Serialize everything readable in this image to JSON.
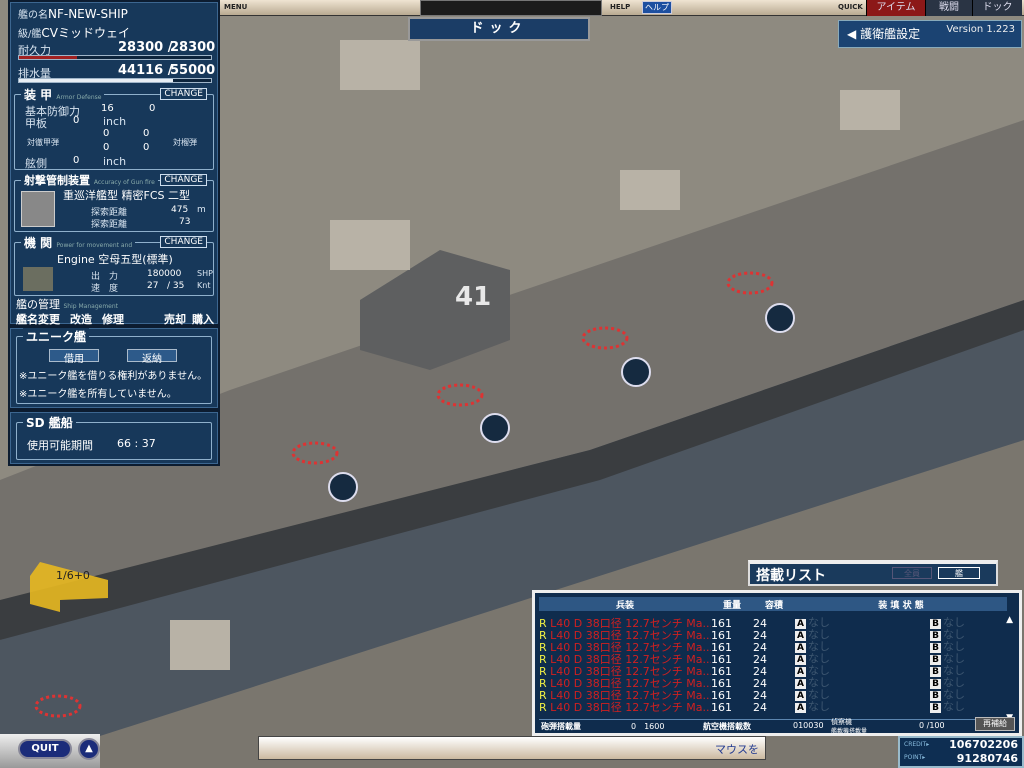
{
  "top": {
    "menu": "MENU",
    "title_bar": "",
    "help": "HELP",
    "help_btn": "ヘルプ",
    "quick": "QUICK",
    "tabs": [
      "アイテム",
      "戦闘",
      "ドック"
    ]
  },
  "screen_title": "ドック",
  "escort_button": "護衛艦設定",
  "version": "Version 1.223",
  "ship": {
    "name_label": "艦の名",
    "name": "NF-NEW-SHIP",
    "class_label": "級/艦",
    "class": "CVミッドウェイ",
    "hp_label": "耐久力",
    "hp": "28300 /",
    "hp_max": "28300",
    "hp_fraction": 0.3,
    "disp_label": "排水量",
    "disp": "44116 /",
    "disp_max": "55000",
    "disp_fraction": 0.8
  },
  "armor": {
    "title": "装 甲",
    "sub": "Armor Defense",
    "change": "CHANGE",
    "base_label": "基本防御力",
    "base": "16",
    "base2": "0",
    "deck_label": "甲板",
    "deck": "0",
    "unit": "inch",
    "vs_ap": "対徹甲弾",
    "vs_he": "対榴弾",
    "v1": "0",
    "v2": "0",
    "v3": "0",
    "v4": "0",
    "side_label": "舷側",
    "side": "0"
  },
  "fcs": {
    "title": "射撃管制装置",
    "sub": "Accuracy of Gun fire",
    "change": "CHANGE",
    "name": "重巡洋艦型 精密FCS 二型",
    "r1_label": "探索距離",
    "r1": "475",
    "r1_unit": "m",
    "r2_label": "探索距離",
    "r2": "73"
  },
  "engine": {
    "title": "機 関",
    "sub": "Power for movement and",
    "change": "CHANGE",
    "name": "Engine 空母五型(標準)",
    "out_label": "出　力",
    "out": "180000",
    "out_unit": "SHP",
    "spd_label": "速　度",
    "spd": "27",
    "spd_max": "/ 35",
    "spd_unit": "Knt"
  },
  "mgmt": {
    "title": "艦の管理",
    "sub": "Ship Management",
    "actions": [
      "艦名変更",
      "改造",
      "修理",
      "売却",
      "購入"
    ]
  },
  "unique": {
    "title": "ユニーク艦",
    "borrow": "借用",
    "return": "返納",
    "msg1": "※ユニーク艦を借りる権利がありません。",
    "msg2": "※ユニーク艦を所有していません。"
  },
  "sd": {
    "title": "SD 艦船",
    "label": "使用可能期間",
    "value": "66 : 37"
  },
  "arrow_label": "1/6+0",
  "loadout": {
    "title": "搭載リスト",
    "btn1": "全員",
    "btn2": "艦",
    "headers": [
      "兵装",
      "重量",
      "容積",
      "装 填 状 態"
    ],
    "rows": [
      {
        "r": "R",
        "name": "L40 D 38口径 12.7センチ Ma...",
        "w": "161",
        "v": "24",
        "a": "なし",
        "b": "なし"
      },
      {
        "r": "R",
        "name": "L40 D 38口径 12.7センチ Ma...",
        "w": "161",
        "v": "24",
        "a": "なし",
        "b": "なし"
      },
      {
        "r": "R",
        "name": "L40 D 38口径 12.7センチ Ma...",
        "w": "161",
        "v": "24",
        "a": "なし",
        "b": "なし"
      },
      {
        "r": "R",
        "name": "L40 D 38口径 12.7センチ Ma...",
        "w": "161",
        "v": "24",
        "a": "なし",
        "b": "なし"
      },
      {
        "r": "R",
        "name": "L40 D 38口径 12.7センチ Ma...",
        "w": "161",
        "v": "24",
        "a": "なし",
        "b": "なし"
      },
      {
        "r": "R",
        "name": "L40 D 38口径 12.7センチ Ma...",
        "w": "161",
        "v": "24",
        "a": "なし",
        "b": "なし"
      },
      {
        "r": "R",
        "name": "L40 D 38口径 12.7センチ Ma...",
        "w": "161",
        "v": "24",
        "a": "なし",
        "b": "なし"
      },
      {
        "r": "R",
        "name": "L40 D 38口径 12.7センチ Ma...",
        "w": "161",
        "v": "24",
        "a": "なし",
        "b": "なし"
      }
    ],
    "ammo_label": "砲弾搭載量",
    "ammo": "0　1600",
    "air_label": "航空機搭載数",
    "air": "010030",
    "recon_label": "偵察機",
    "recon_sub": "艦載機搭載量",
    "recon": "0 /100",
    "resupply": "再補給"
  },
  "bottom": {
    "quit": "QUIT",
    "hint": "マウスを",
    "credit_label": "CREDIT▸",
    "credit": "106702206",
    "point_label": "POINT▸",
    "point": "91280746"
  }
}
